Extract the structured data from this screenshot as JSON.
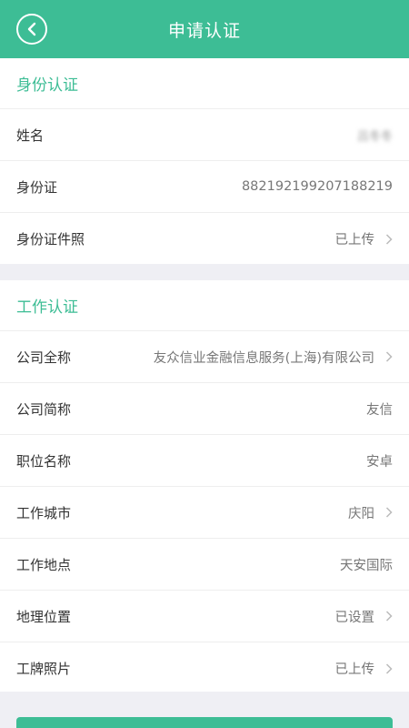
{
  "header": {
    "title": "申请认证",
    "back_icon": "back-arrow-circle-icon"
  },
  "identity": {
    "title": "身份认证",
    "rows": [
      {
        "label": "姓名",
        "value": "吕冬冬"
      },
      {
        "label": "身份证",
        "value": "882192199207188219"
      },
      {
        "label": "身份证件照",
        "value": "已上传"
      }
    ]
  },
  "work": {
    "title": "工作认证",
    "rows": [
      {
        "label": "公司全称",
        "value": "友众信业金融信息服务(上海)有限公司"
      },
      {
        "label": "公司简称",
        "value": "友信"
      },
      {
        "label": "职位名称",
        "value": "安卓"
      },
      {
        "label": "工作城市",
        "value": "庆阳"
      },
      {
        "label": "工作地点",
        "value": "天安国际"
      },
      {
        "label": "地理位置",
        "value": "已设置"
      },
      {
        "label": "工牌照片",
        "value": "已上传"
      }
    ]
  },
  "colors": {
    "accent": "#3dbd95",
    "background": "#efeff4"
  }
}
